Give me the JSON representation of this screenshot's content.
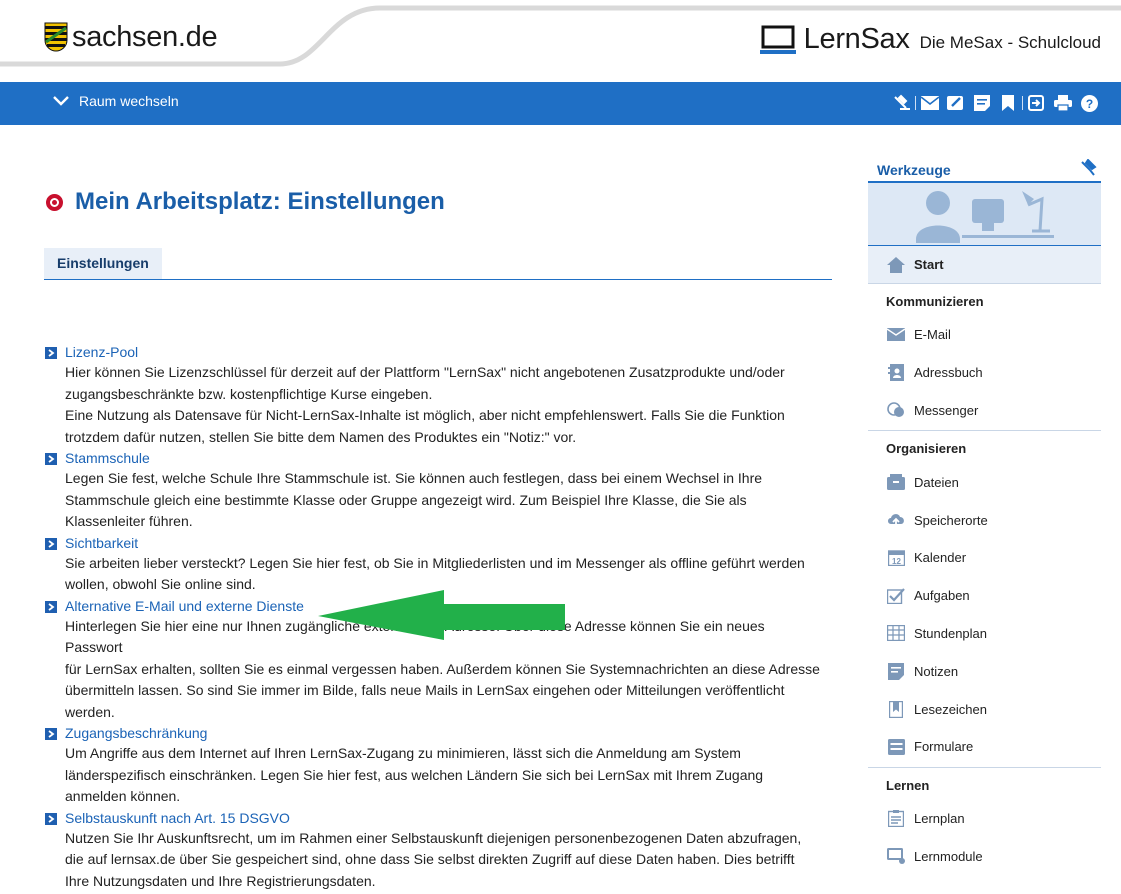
{
  "header": {
    "brand": "sachsen.de",
    "app_name": "LernSax",
    "app_subtitle": "Die MeSax - Schulcloud"
  },
  "navbar": {
    "room_switch_label": "Raum wechseln",
    "icons": [
      "tools-icon",
      "mail-icon",
      "edit-icon",
      "notes-icon",
      "bookmark-icon",
      "logout-icon",
      "print-icon",
      "help-icon"
    ]
  },
  "page": {
    "title": "Mein Arbeitsplatz: Einstellungen",
    "tab_label": "Einstellungen"
  },
  "items": [
    {
      "title": "Lizenz-Pool",
      "lines": [
        "Hier können Sie Lizenzschlüssel für derzeit auf der Plattform \"LernSax\" nicht angebotenen Zusatzprodukte und/oder",
        "zugangsbeschränkte bzw. kostenpflichtige Kurse eingeben.",
        "Eine Nutzung als Datensave für Nicht-LernSax-Inhalte ist möglich, aber nicht empfehlenswert. Falls Sie die Funktion",
        "trotzdem dafür nutzen, stellen Sie bitte dem Namen des Produktes ein \"Notiz:\" vor."
      ]
    },
    {
      "title": "Stammschule",
      "lines": [
        "Legen Sie fest, welche Schule Ihre Stammschule ist. Sie können auch festlegen, dass bei einem Wechsel in Ihre",
        "Stammschule gleich eine bestimmte Klasse oder Gruppe angezeigt wird. Zum Beispiel Ihre Klasse, die Sie als",
        "Klassenleiter führen."
      ]
    },
    {
      "title": "Sichtbarkeit",
      "lines": [
        "Sie arbeiten lieber versteckt? Legen Sie hier fest, ob Sie in Mitgliederlisten und im Messenger als offline geführt werden",
        "wollen, obwohl Sie online sind."
      ]
    },
    {
      "title": "Alternative E-Mail und externe Dienste",
      "lines": [
        "Hinterlegen Sie hier eine nur Ihnen zugängliche externe Mail-Adresse. Über diese Adresse können Sie ein neues Passwort",
        "für LernSax erhalten, sollten Sie es einmal vergessen haben. Außerdem können Sie Systemnachrichten an diese Adresse",
        "übermitteln lassen. So sind Sie immer im Bilde, falls neue Mails in LernSax eingehen oder Mitteilungen veröffentlicht",
        "werden."
      ]
    },
    {
      "title": "Zugangsbeschränkung",
      "lines": [
        "Um Angriffe aus dem Internet auf Ihren LernSax-Zugang zu minimieren, lässt sich die Anmeldung am System",
        "länderspezifisch einschränken. Legen Sie hier fest, aus welchen Ländern Sie sich bei LernSax mit Ihrem Zugang",
        "anmelden können."
      ]
    },
    {
      "title": "Selbstauskunft nach Art. 15 DSGVO",
      "lines": [
        "Nutzen Sie Ihr Auskunftsrecht, um im Rahmen einer Selbstauskunft diejenigen personenbezogenen Daten abzufragen,",
        "die auf lernsax.de über Sie gespeichert sind, ohne dass Sie selbst direkten Zugriff auf diese Daten haben. Dies betrifft",
        "Ihre Nutzungsdaten und Ihre Registrierungsdaten."
      ]
    }
  ],
  "sidebar": {
    "title": "Werkzeuge",
    "start_label": "Start",
    "sections": [
      {
        "title": "Kommunizieren",
        "items": [
          {
            "label": "E-Mail",
            "icon": "mail-icon"
          },
          {
            "label": "Adressbuch",
            "icon": "addressbook-icon"
          },
          {
            "label": "Messenger",
            "icon": "messenger-icon"
          }
        ]
      },
      {
        "title": "Organisieren",
        "items": [
          {
            "label": "Dateien",
            "icon": "files-icon"
          },
          {
            "label": "Speicherorte",
            "icon": "cloud-icon"
          },
          {
            "label": "Kalender",
            "icon": "calendar-icon"
          },
          {
            "label": "Aufgaben",
            "icon": "tasks-icon"
          },
          {
            "label": "Stundenplan",
            "icon": "timetable-icon"
          },
          {
            "label": "Notizen",
            "icon": "notes-icon"
          },
          {
            "label": "Lesezeichen",
            "icon": "bookmark-icon"
          },
          {
            "label": "Formulare",
            "icon": "forms-icon"
          }
        ]
      },
      {
        "title": "Lernen",
        "items": [
          {
            "label": "Lernplan",
            "icon": "lernplan-icon"
          },
          {
            "label": "Lernmodule",
            "icon": "lernmodule-icon"
          }
        ]
      }
    ]
  },
  "colors": {
    "primary_blue": "#1f6fc5",
    "link_blue": "#1b63b6",
    "title_red": "#c8102e",
    "annotation_green": "#22b04a",
    "sidebar_icon": "#7d98b8"
  }
}
